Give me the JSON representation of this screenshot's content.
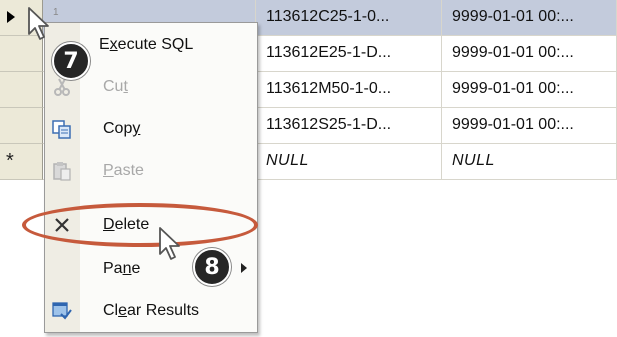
{
  "grid": {
    "rows": [
      {
        "first": "1",
        "c1": "113612C25-1-0...",
        "c2": "9999-01-01 00:...",
        "current": true,
        "selected": true
      },
      {
        "first": "",
        "c1": "113612E25-1-D...",
        "c2": "9999-01-01 00:...",
        "current": false,
        "selected": false
      },
      {
        "first": "",
        "c1": "113612M50-1-0...",
        "c2": "9999-01-01 00:...",
        "current": false,
        "selected": false
      },
      {
        "first": "",
        "c1": "113612S25-1-D...",
        "c2": "9999-01-01 00:...",
        "current": false,
        "selected": false
      },
      {
        "first": "",
        "c1": "NULL",
        "c2": "NULL",
        "new_row_marker": "*"
      }
    ]
  },
  "context_menu": {
    "items": [
      {
        "pre": "E",
        "u": "x",
        "post": "ecute SQL",
        "icon": "none",
        "enabled": true
      },
      {
        "pre": "Cu",
        "u": "t",
        "post": "",
        "icon": "scissors-icon",
        "enabled": false
      },
      {
        "pre": "Cop",
        "u": "y",
        "post": "",
        "icon": "copy-icon",
        "enabled": true
      },
      {
        "pre": "",
        "u": "P",
        "post": "aste",
        "icon": "paste-icon",
        "enabled": false
      },
      {
        "pre": "",
        "u": "D",
        "post": "elete",
        "icon": "delete-x-icon",
        "enabled": true
      },
      {
        "pre": "Pa",
        "u": "n",
        "post": "e",
        "icon": "none",
        "enabled": true,
        "submenu": true
      },
      {
        "pre": "Cl",
        "u": "e",
        "post": "ar Results",
        "icon": "clear-results-icon",
        "enabled": true
      }
    ]
  },
  "annotations": {
    "step_a": "7",
    "step_b": "8",
    "highlight_color": "#c65a3c"
  }
}
